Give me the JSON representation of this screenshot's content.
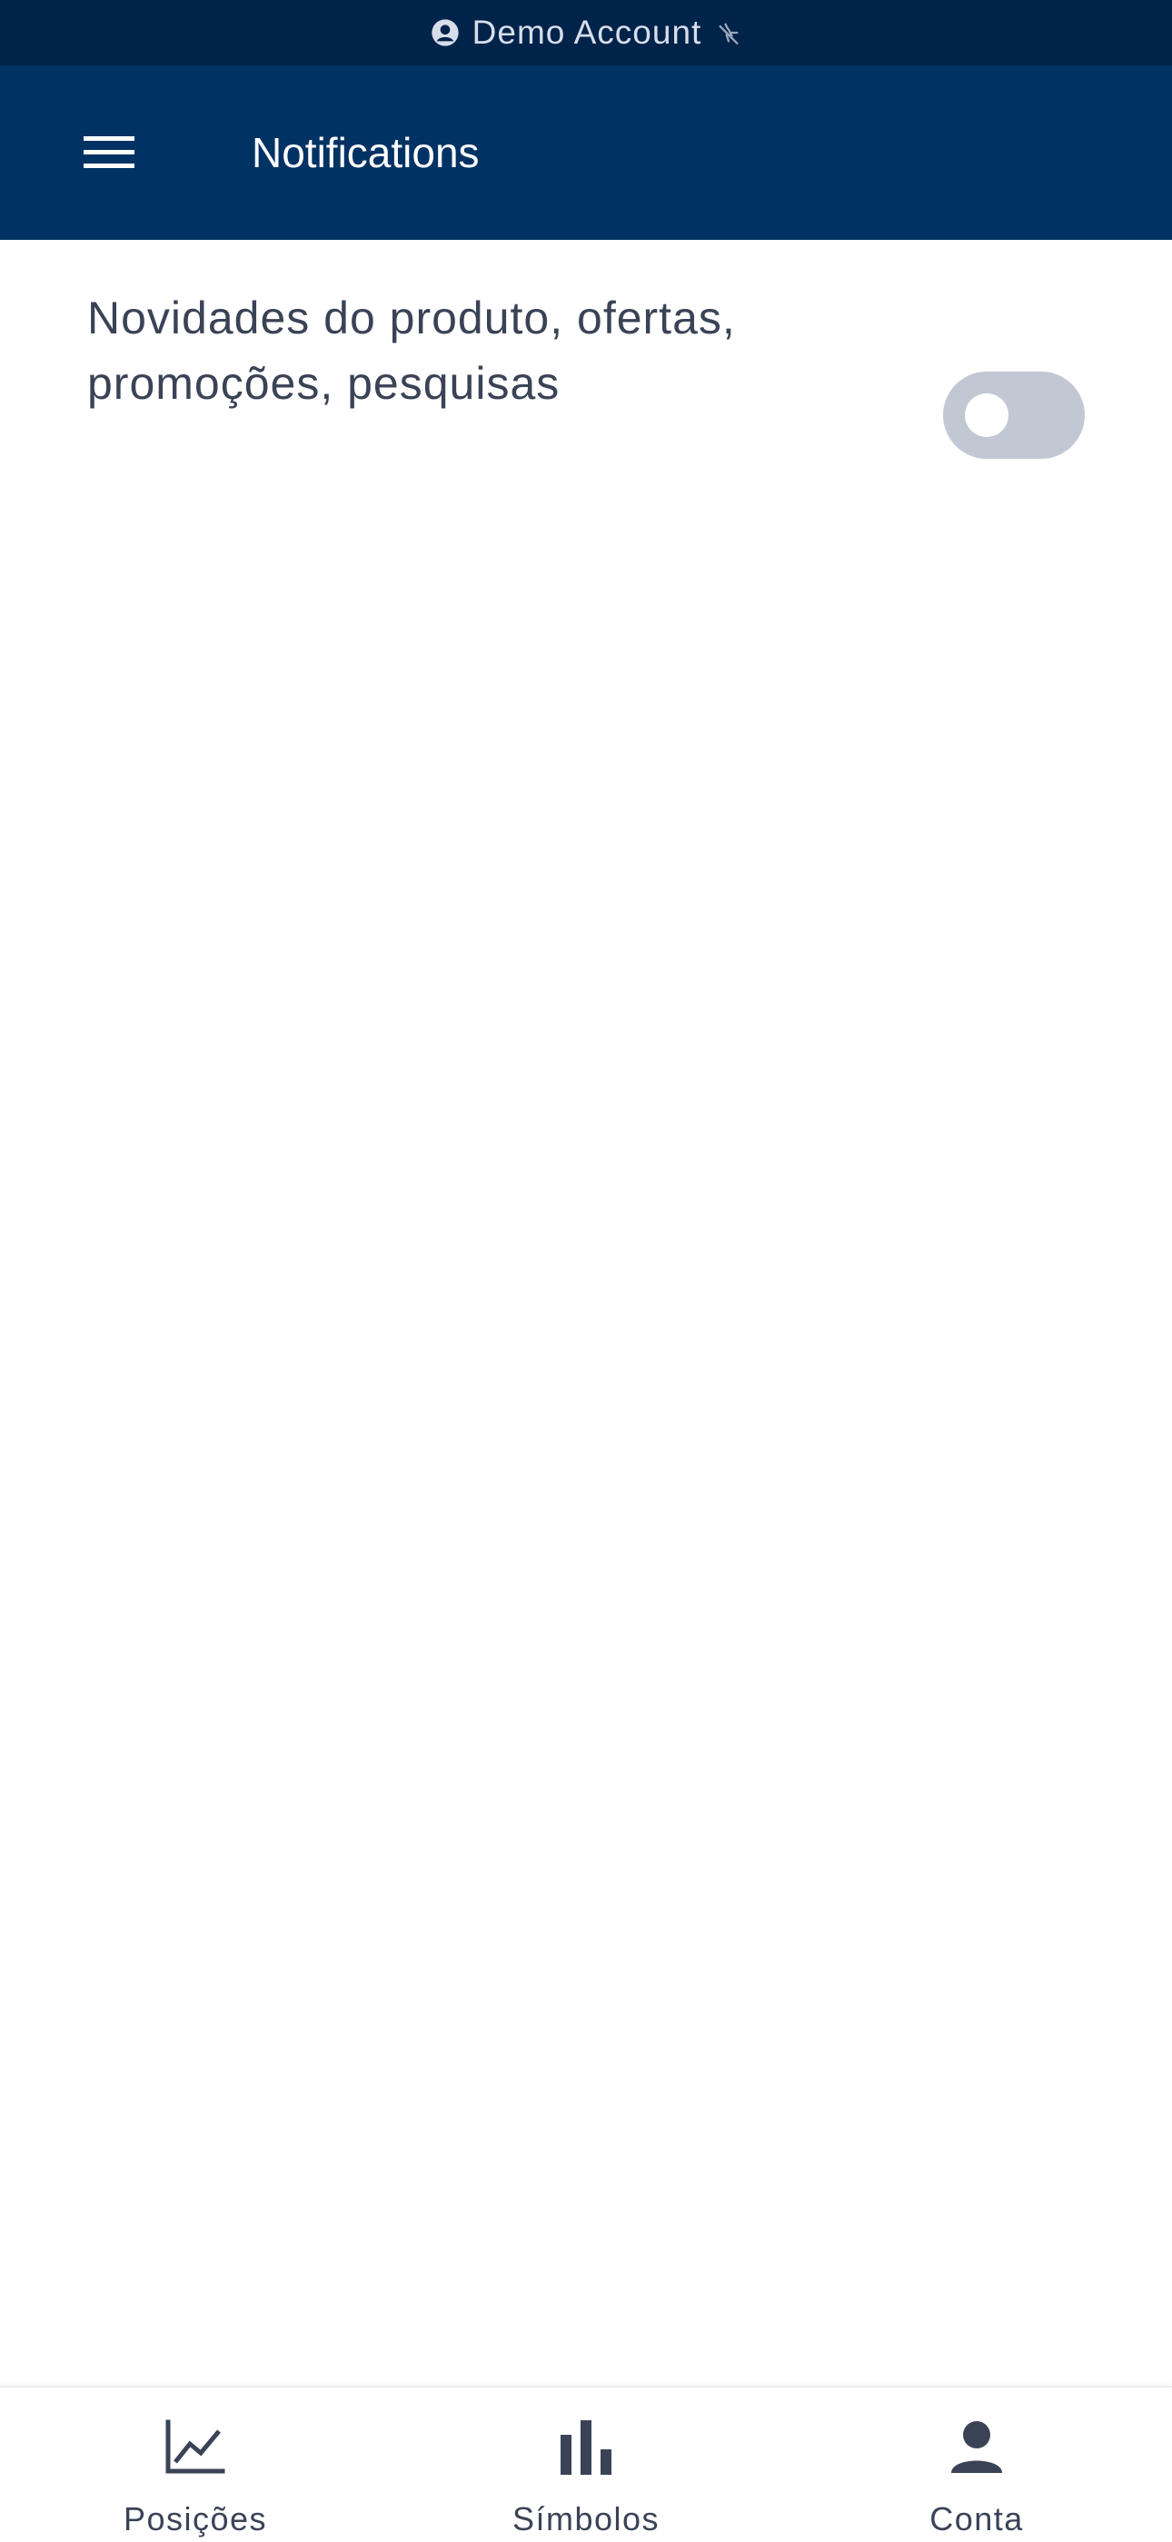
{
  "status_bar": {
    "account_label": "Demo Account",
    "account_icon": "account-circle-icon",
    "signal_icon": "signal-off-icon"
  },
  "header": {
    "title": "Notifications",
    "menu_icon": "hamburger-menu-icon"
  },
  "settings": [
    {
      "label": "Novidades do produto, ofertas, promoções, pesquisas",
      "enabled": false
    }
  ],
  "bottom_nav": {
    "items": [
      {
        "label": "Posições",
        "icon": "line-chart-icon"
      },
      {
        "label": "Símbolos",
        "icon": "bar-chart-icon"
      },
      {
        "label": "Conta",
        "icon": "person-icon"
      }
    ]
  },
  "colors": {
    "status_bar_bg": "#00234a",
    "header_bg": "#003264",
    "toggle_off": "#c1c8d4",
    "text_primary": "#3a4356"
  }
}
